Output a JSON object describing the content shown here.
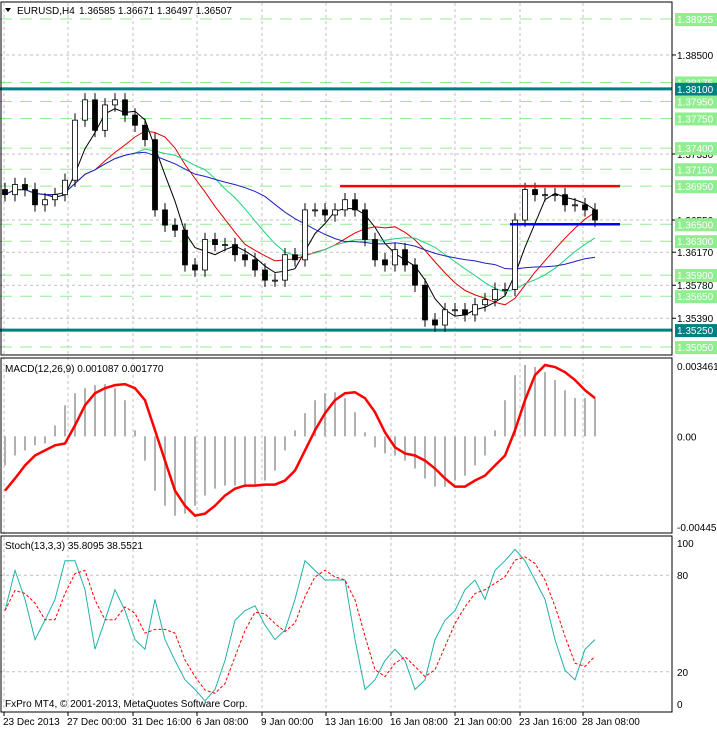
{
  "header": {
    "symbol": "EURUSD,H4",
    "ohlc": "1.36585 1.36671 1.36497 1.36507"
  },
  "price_axis": {
    "labels": [
      {
        "value": "1.38925",
        "kind": "level"
      },
      {
        "value": "1.38500",
        "kind": "tick"
      },
      {
        "value": "1.38175",
        "kind": "level"
      },
      {
        "value": "1.38100",
        "kind": "strong"
      },
      {
        "value": "1.37950",
        "kind": "level"
      },
      {
        "value": "1.37750",
        "kind": "level"
      },
      {
        "value": "1.37330",
        "kind": "tick"
      },
      {
        "value": "1.37400",
        "kind": "level"
      },
      {
        "value": "1.37150",
        "kind": "level"
      },
      {
        "value": "1.36950",
        "kind": "level"
      },
      {
        "value": "1.36550",
        "kind": "tick"
      },
      {
        "value": "1.36500",
        "kind": "level"
      },
      {
        "value": "1.36170",
        "kind": "tick"
      },
      {
        "value": "1.36300",
        "kind": "level"
      },
      {
        "value": "1.35780",
        "kind": "tick"
      },
      {
        "value": "1.35900",
        "kind": "level"
      },
      {
        "value": "1.35650",
        "kind": "level"
      },
      {
        "value": "1.35390",
        "kind": "tick"
      },
      {
        "value": "1.35250",
        "kind": "strong"
      },
      {
        "value": "1.35050",
        "kind": "level"
      }
    ],
    "range": [
      1.3505,
      1.38925
    ]
  },
  "lines": {
    "resistance": 1.3695,
    "support": 1.365
  },
  "colors": {
    "level_bg": "#90ee90",
    "strong": "#008080",
    "resistance": "#ff0000",
    "support": "#0000ff",
    "ma_black": "#000000",
    "ma_red": "#e00000",
    "ma_green": "#20d080",
    "ma_blue": "#2020c0",
    "stoch_main": "#20b2aa",
    "stoch_signal": "#ff0000"
  },
  "candles_close": [
    1.3685,
    1.3697,
    1.3691,
    1.3673,
    1.3679,
    1.3685,
    1.3702,
    1.3773,
    1.3797,
    1.3761,
    1.3791,
    1.3797,
    1.3779,
    1.3767,
    1.375,
    1.3667,
    1.3649,
    1.3643,
    1.3602,
    1.3596,
    1.3632,
    1.3626,
    1.3626,
    1.3614,
    1.3608,
    1.3596,
    1.3584,
    1.3584,
    1.3614,
    1.3608,
    1.3667,
    1.3667,
    1.3661,
    1.3667,
    1.3679,
    1.3667,
    1.3632,
    1.3608,
    1.3602,
    1.362,
    1.3602,
    1.3578,
    1.3537,
    1.3531,
    1.3549,
    1.3549,
    1.3543,
    1.3555,
    1.3561,
    1.3573,
    1.3573,
    1.3655,
    1.3691,
    1.3685,
    1.3685,
    1.3685,
    1.3673,
    1.3673,
    1.3667,
    1.3655
  ],
  "macd": {
    "label": "MACD(12,26,9) 0.001087 0.001770",
    "axis": {
      "top": "0.003461",
      "zero": "0.00",
      "bottom": "-0.004456"
    },
    "range": [
      -0.004456,
      0.003461
    ],
    "signal": [
      -0.00267,
      -0.00207,
      -0.00143,
      -0.00094,
      -0.00069,
      -0.00044,
      -0.00035,
      0.00054,
      0.00153,
      0.00212,
      0.00237,
      0.00252,
      0.00257,
      0.00237,
      0.00178,
      0.0003,
      -0.00119,
      -0.00267,
      -0.00341,
      -0.0039,
      -0.0038,
      -0.00341,
      -0.00291,
      -0.00257,
      -0.00242,
      -0.00242,
      -0.00237,
      -0.00237,
      -0.00217,
      -0.00168,
      -0.00069,
      0.0003,
      0.00114,
      0.00178,
      0.00212,
      0.00217,
      0.00188,
      0.00119,
      0.0002,
      -0.00054,
      -0.00084,
      -0.00094,
      -0.00119,
      -0.00158,
      -0.00207,
      -0.00247,
      -0.00247,
      -0.00217,
      -0.00193,
      -0.00143,
      -0.00094,
      0.0003,
      0.00178,
      0.00301,
      0.00351,
      0.00341,
      0.00316,
      0.00277,
      0.00227,
      0.00188
    ]
  },
  "stoch": {
    "label": "Stoch(13,3,3) 35.8095 38.5521",
    "axis": {
      "top": "100",
      "upper": "80",
      "lower": "20",
      "bottom": "0"
    },
    "main": [
      58,
      83,
      65,
      40,
      52,
      65,
      89,
      89,
      71,
      34,
      52,
      71,
      58,
      40,
      34,
      65,
      40,
      27,
      15,
      9,
      2,
      9,
      27,
      52,
      58,
      61,
      49,
      40,
      46,
      65,
      89,
      83,
      77,
      77,
      77,
      40,
      9,
      15,
      27,
      34,
      27,
      9,
      15,
      40,
      52,
      58,
      71,
      77,
      65,
      83,
      89,
      96,
      89,
      77,
      65,
      40,
      21,
      15,
      34,
      40
    ]
  },
  "time_axis": [
    "23 Dec 2013",
    "27 Dec 00:00",
    "31 Dec 16:00",
    "6 Jan 08:00",
    "9 Jan 00:00",
    "13 Jan 16:00",
    "16 Jan 08:00",
    "21 Jan 00:00",
    "23 Jan 16:00",
    "28 Jan 08:00"
  ],
  "copyright": "FxPro MT4, © 2001-2013, MetaQuotes Software Corp."
}
